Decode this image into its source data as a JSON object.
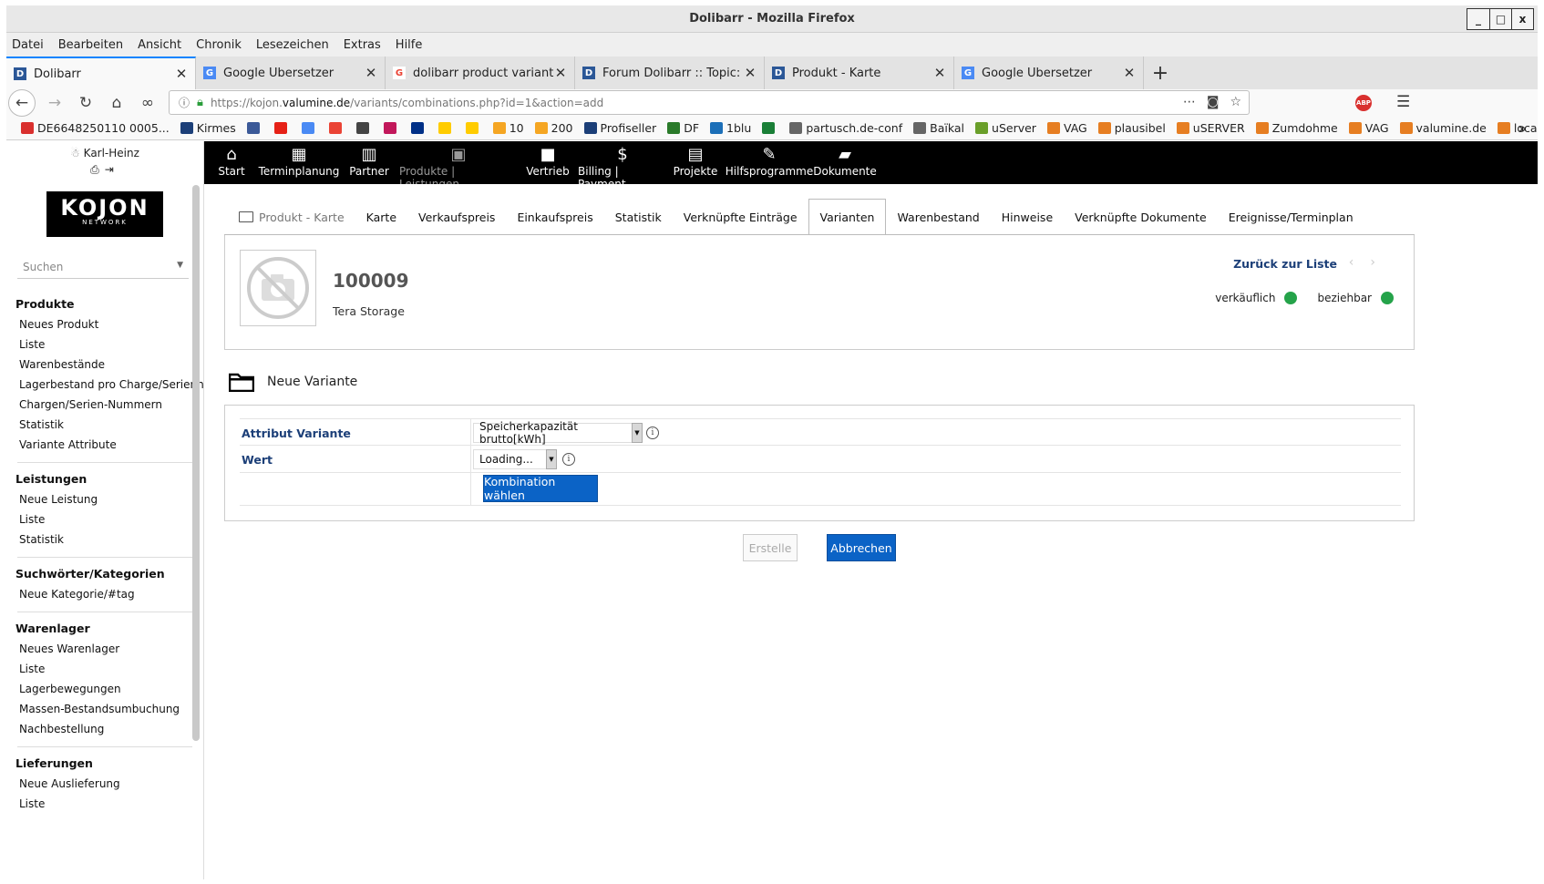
{
  "window": {
    "title": "Dolibarr - Mozilla Firefox",
    "controls": [
      "_",
      "□",
      "x"
    ]
  },
  "menubar": [
    "Datei",
    "Bearbeiten",
    "Ansicht",
    "Chronik",
    "Lesezeichen",
    "Extras",
    "Hilfe"
  ],
  "tabs": [
    {
      "label": "Dolibarr",
      "icon": "dolibarr-icon",
      "color": "#2b5797"
    },
    {
      "label": "Google Übersetzer",
      "icon": "google-translate-icon",
      "color": "#4a8af4"
    },
    {
      "label": "dolibarr product variant valu",
      "icon": "google-icon",
      "color": "#ea4335"
    },
    {
      "label": "Forum Dolibarr :: Topic: How",
      "icon": "dolibarr-icon",
      "color": "#2b5797"
    },
    {
      "label": "Produkt - Karte",
      "icon": "dolibarr-icon",
      "color": "#2b5797"
    },
    {
      "label": "Google Übersetzer",
      "icon": "google-translate-icon",
      "color": "#4a8af4"
    }
  ],
  "url": {
    "prefix": "https://kojon.",
    "host": "valumine.de",
    "path": "/variants/combinations.php?id=1&action=add"
  },
  "abp_label": "ABP",
  "bookmarks": [
    {
      "label": "DE6648250110 0005...",
      "color": "#d9302e"
    },
    {
      "label": "Kirmes",
      "color": "#1c3f78"
    },
    {
      "label": "",
      "color": "#3b5998"
    },
    {
      "label": "",
      "color": "#e62117"
    },
    {
      "label": "",
      "color": "#4a8af4"
    },
    {
      "label": "",
      "color": "#ea4335"
    },
    {
      "label": "",
      "color": "#444444"
    },
    {
      "label": "",
      "color": "#c2185b"
    },
    {
      "label": "",
      "color": "#003087"
    },
    {
      "label": "",
      "color": "#ffcc00"
    },
    {
      "label": "",
      "color": "#ffcc00"
    },
    {
      "label": "10",
      "color": "#f5a623"
    },
    {
      "label": "200",
      "color": "#f5a623"
    },
    {
      "label": "Profiseller",
      "color": "#1c3f78"
    },
    {
      "label": "DF",
      "color": "#2a7a2a"
    },
    {
      "label": "1blu",
      "color": "#1c6fb8"
    },
    {
      "label": "",
      "color": "#1a7f37"
    },
    {
      "label": "partusch.de-conf",
      "color": "#666666"
    },
    {
      "label": "Baïkal",
      "color": "#666666"
    },
    {
      "label": "uServer",
      "color": "#6a9f2a"
    },
    {
      "label": "VAG",
      "color": "#e67e22"
    },
    {
      "label": "plausibel",
      "color": "#e67e22"
    },
    {
      "label": "uSERVER",
      "color": "#e67e22"
    },
    {
      "label": "Zumdohme",
      "color": "#e67e22"
    },
    {
      "label": "VAG",
      "color": "#e67e22"
    },
    {
      "label": "valumine.de",
      "color": "#e67e22"
    },
    {
      "label": "local",
      "color": "#e67e22"
    }
  ],
  "sidebar": {
    "user": "Karl-Heinz",
    "logo_main": "KOJON",
    "logo_sub": "NETWORK",
    "search_placeholder": "Suchen",
    "sections": [
      {
        "title": "Produkte",
        "items": [
          "Neues Produkt",
          "Liste",
          "Warenbestände",
          "Lagerbestand pro Charge/Serienn.",
          "Chargen/Serien-Nummern",
          "Statistik",
          "Variante Attribute"
        ]
      },
      {
        "title": "Leistungen",
        "items": [
          "Neue Leistung",
          "Liste",
          "Statistik"
        ]
      },
      {
        "title": "Suchwörter/Kategorien",
        "items": [
          "Neue Kategorie/#tag"
        ]
      },
      {
        "title": "Warenlager",
        "items": [
          "Neues Warenlager",
          "Liste",
          "Lagerbewegungen",
          "Massen-Bestandsumbuchung",
          "Nachbestellung"
        ]
      },
      {
        "title": "Lieferungen",
        "items": [
          "Neue Auslieferung",
          "Liste"
        ]
      }
    ]
  },
  "topnav": [
    {
      "label": "Start",
      "icon": "home-icon",
      "dim": false
    },
    {
      "label": "Terminplanung",
      "icon": "calendar-icon",
      "dim": false
    },
    {
      "label": "Partner",
      "icon": "building-icon",
      "dim": false
    },
    {
      "label": "Produkte | Leistungen",
      "icon": "image-icon",
      "dim": true
    },
    {
      "label": "Vertrieb",
      "icon": "briefcase-icon",
      "dim": false
    },
    {
      "label": "Billing | Payment",
      "icon": "dollar-icon",
      "dim": false
    },
    {
      "label": "Projekte",
      "icon": "clipboard-icon",
      "dim": false
    },
    {
      "label": "Hilfsprogramme",
      "icon": "wrench-icon",
      "dim": false
    },
    {
      "label": "Dokumente",
      "icon": "folder-user-icon",
      "dim": false
    }
  ],
  "subtabs": [
    "Produkt - Karte",
    "Karte",
    "Verkaufspreis",
    "Einkaufspreis",
    "Statistik",
    "Verknüpfte Einträge",
    "Varianten",
    "Warenbestand",
    "Hinweise",
    "Verknüpfte Dokumente",
    "Ereignisse/Terminplan"
  ],
  "active_subtab": "Varianten",
  "product": {
    "ref": "100009",
    "label": "Tera Storage",
    "back_to_list": "Zurück zur Liste",
    "status_sell_label": "verkäuflich",
    "status_buy_label": "beziehbar",
    "status_color": "#25a34a"
  },
  "section_title": "Neue Variante",
  "form": {
    "attribute_label": "Attribut Variante",
    "attribute_value": "Speicherkapazität brutto[kWh]",
    "value_label": "Wert",
    "value_value": "Loading...",
    "choose_button": "Kombination wählen",
    "create_button": "Erstelle",
    "cancel_button": "Abbrechen"
  }
}
